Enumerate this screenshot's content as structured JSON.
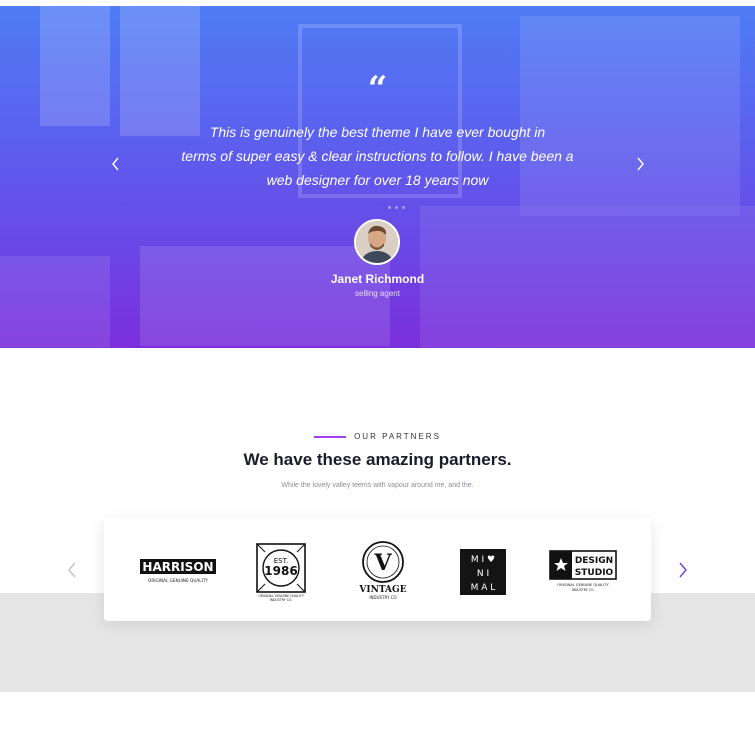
{
  "testimonial": {
    "quote_mark": "“",
    "quote_line1": "This is genuinely the best theme I have ever bought in",
    "quote_line2": "terms of super easy & clear instructions to follow. I have been a",
    "quote_line3": "web designer for over 18 years now",
    "name": "Janet Richmond",
    "role": "selling agent",
    "prev_icon": "chevron-left-icon",
    "next_icon": "chevron-right-icon"
  },
  "partners": {
    "label": "OUR PARTNERS",
    "title": "We have these amazing partners.",
    "subtitle": "While the lovely valley teems with vapour around me, and the.",
    "accent_color": "#a33ff0",
    "logos": [
      {
        "name": "HARRISON",
        "tagline": "ORIGINAL GENUINE QUALITY"
      },
      {
        "name": "EST. 1986",
        "line1": "EST.",
        "line2": "1986",
        "tagline": "ORIGINAL GENUINE QUALITY",
        "sub": "INDUSTRY CO."
      },
      {
        "name": "VINTAGE",
        "letter": "V",
        "tagline": "INDUSTRY CO"
      },
      {
        "name": "MINIMAL",
        "rows": [
          "M I ♥",
          "N I",
          "M A L"
        ]
      },
      {
        "name": "DESIGN STUDIO",
        "line1": "DESIGN",
        "line2": "STUDIO",
        "tagline": "ORIGINAL GENUINE QUALITY",
        "sub": "INDUSTRY CO."
      }
    ]
  },
  "colors": {
    "hero_gradient_top": "#4f7cf5",
    "hero_gradient_bottom": "#7b2fdb",
    "arrow_active": "#6a3fe0",
    "arrow_inactive": "#b9b9c4"
  }
}
